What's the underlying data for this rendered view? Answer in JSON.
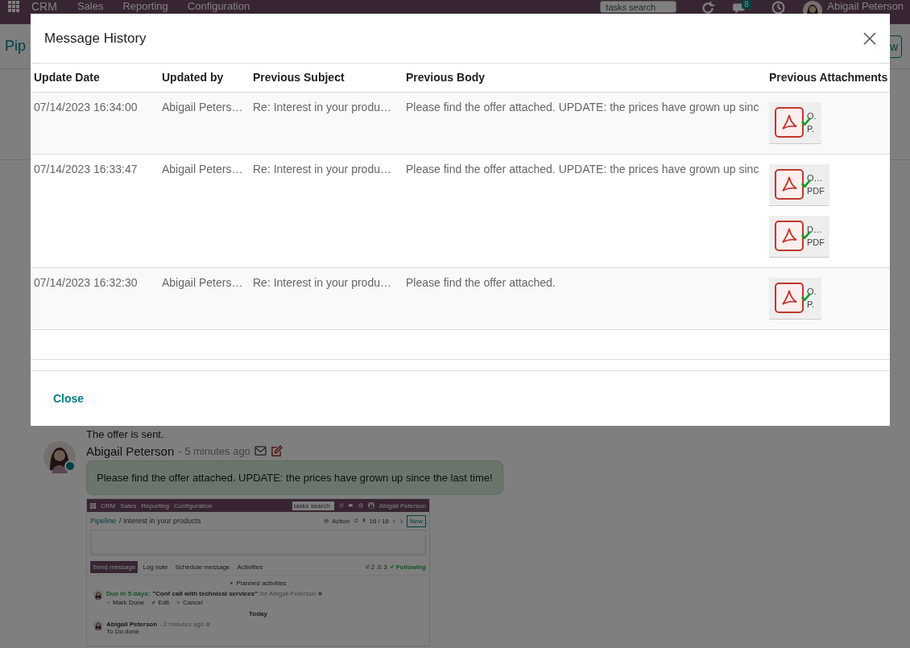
{
  "navbar": {
    "app_name": "CRM",
    "menus": [
      "Sales",
      "Reporting",
      "Configuration"
    ],
    "search": {
      "placeholder": "tasks search"
    },
    "chat_badge": "8",
    "user": "Abigail Peterson"
  },
  "control_panel": {
    "breadcrumb": "Pip",
    "new_button": "w"
  },
  "dialog": {
    "title": "Message History",
    "table": {
      "columns": [
        "Update Date",
        "Updated by",
        "Previous Subject",
        "Previous Body",
        "Previous Attachments"
      ],
      "rows": [
        {
          "update_date": "07/14/2023 16:34:00",
          "updated_by": "Abigail Peters…",
          "previous_subject": "Re: Interest in your produ…",
          "previous_body": "Please find the offer attached. UPDATE: the prices have grown up sinc",
          "attachments": [
            {
              "name": "O.",
              "type": "P."
            }
          ]
        },
        {
          "update_date": "07/14/2023 16:33:47",
          "updated_by": "Abigail Peters…",
          "previous_subject": "Re: Interest in your produ…",
          "previous_body": "Please find the offer attached. UPDATE: the prices have grown up sinc",
          "attachments": [
            {
              "name": "O…",
              "type": "PDF"
            },
            {
              "name": "D…",
              "type": "PDF"
            }
          ]
        },
        {
          "update_date": "07/14/2023 16:32:30",
          "updated_by": "Abigail Peters…",
          "previous_subject": "Re: Interest in your produ…",
          "previous_body": "Please find the offer attached.",
          "attachments": [
            {
              "name": "O.",
              "type": "P."
            }
          ]
        }
      ]
    },
    "footer_button": "Close"
  },
  "chatter": {
    "note": "The offer is sent.",
    "message": {
      "author": "Abigail Peterson",
      "time": "- 5 minutes ago",
      "body": "Please find the offer attached. UPDATE: the prices have grown up since the last time!",
      "screenshot": {
        "navbar": {
          "app_name": "CRM",
          "menus": [
            "Sales",
            "Reporting",
            "Configuration"
          ],
          "search": {
            "placeholder": "tasks search"
          },
          "user": "Abigail Peterson"
        },
        "breadcrumb_link": "Pipeline",
        "breadcrumb_current": "/ Interest in your products",
        "action": "Action",
        "pager": "16 / 16",
        "new_button": "New",
        "tabs": [
          {
            "label": "Send message",
            "selected": true
          },
          {
            "label": "Log note",
            "selected": false
          },
          {
            "label": "Schedule message",
            "selected": false
          },
          {
            "label": "Activities",
            "selected": false
          }
        ],
        "attachment_count": "2",
        "follower_count": "3",
        "following": "Following",
        "planned_heading": "Planned activities",
        "activity": {
          "due": "Due in 5 days:",
          "summary": "\"Conf call with technical services\"",
          "assignee": "for Abigail Peterson",
          "actions": [
            "Mark Done",
            "Edit",
            "Cancel"
          ]
        },
        "date_separator": "Today",
        "message": {
          "author": "Abigail Peterson",
          "time": "- 2 minutes ago",
          "body": "To Do done"
        }
      }
    }
  }
}
